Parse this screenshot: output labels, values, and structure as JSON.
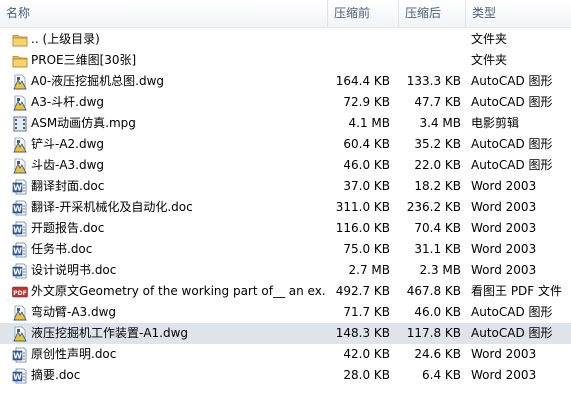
{
  "header": {
    "name": "名称",
    "before": "压缩前",
    "after": "压缩后",
    "type": "类型"
  },
  "rows": [
    {
      "name": ".. (上级目录)",
      "before": "",
      "after": "",
      "type": "文件夹",
      "icon": "folder-icon"
    },
    {
      "name": "PROE三维图[30张]",
      "before": "",
      "after": "",
      "type": "文件夹",
      "icon": "folder-icon"
    },
    {
      "name": "A0-液压挖掘机总图.dwg",
      "before": "164.4 KB",
      "after": "133.3 KB",
      "type": "AutoCAD 图形",
      "icon": "dwg-icon"
    },
    {
      "name": "A3-斗杆.dwg",
      "before": "72.9 KB",
      "after": "47.7 KB",
      "type": "AutoCAD 图形",
      "icon": "dwg-icon"
    },
    {
      "name": "ASM动画仿真.mpg",
      "before": "4.1 MB",
      "after": "3.4 MB",
      "type": "电影剪辑",
      "icon": "video-icon"
    },
    {
      "name": "铲斗-A2.dwg",
      "before": "60.4 KB",
      "after": "35.2 KB",
      "type": "AutoCAD 图形",
      "icon": "dwg-icon"
    },
    {
      "name": "斗齿-A3.dwg",
      "before": "46.0 KB",
      "after": "22.0 KB",
      "type": "AutoCAD 图形",
      "icon": "dwg-icon"
    },
    {
      "name": "翻译封面.doc",
      "before": "37.0 KB",
      "after": "18.2 KB",
      "type": "Word 2003",
      "icon": "word-icon"
    },
    {
      "name": "翻译-开采机械化及自动化.doc",
      "before": "311.0 KB",
      "after": "236.2 KB",
      "type": "Word 2003",
      "icon": "word-icon"
    },
    {
      "name": "开题报告.doc",
      "before": "116.0 KB",
      "after": "70.4 KB",
      "type": "Word 2003",
      "icon": "word-icon"
    },
    {
      "name": "任务书.doc",
      "before": "75.0 KB",
      "after": "31.1 KB",
      "type": "Word 2003",
      "icon": "word-icon"
    },
    {
      "name": "设计说明书.doc",
      "before": "2.7 MB",
      "after": "2.3 MB",
      "type": "Word 2003",
      "icon": "word-icon"
    },
    {
      "name": "外文原文Geometry of the working part of__ an ex...",
      "before": "492.7 KB",
      "after": "467.8 KB",
      "type": "看图王 PDF 文件",
      "icon": "pdf-icon"
    },
    {
      "name": "弯动臂-A3.dwg",
      "before": "71.7 KB",
      "after": "46.0 KB",
      "type": "AutoCAD 图形",
      "icon": "dwg-icon"
    },
    {
      "name": "液压挖掘机工作装置-A1.dwg",
      "before": "148.3 KB",
      "after": "117.8 KB",
      "type": "AutoCAD 图形",
      "icon": "dwg-icon",
      "selected": true
    },
    {
      "name": "原创性声明.doc",
      "before": "42.0 KB",
      "after": "24.6 KB",
      "type": "Word 2003",
      "icon": "word-icon"
    },
    {
      "name": "摘要.doc",
      "before": "28.0 KB",
      "after": "6.4 KB",
      "type": "Word 2003",
      "icon": "word-icon"
    }
  ]
}
